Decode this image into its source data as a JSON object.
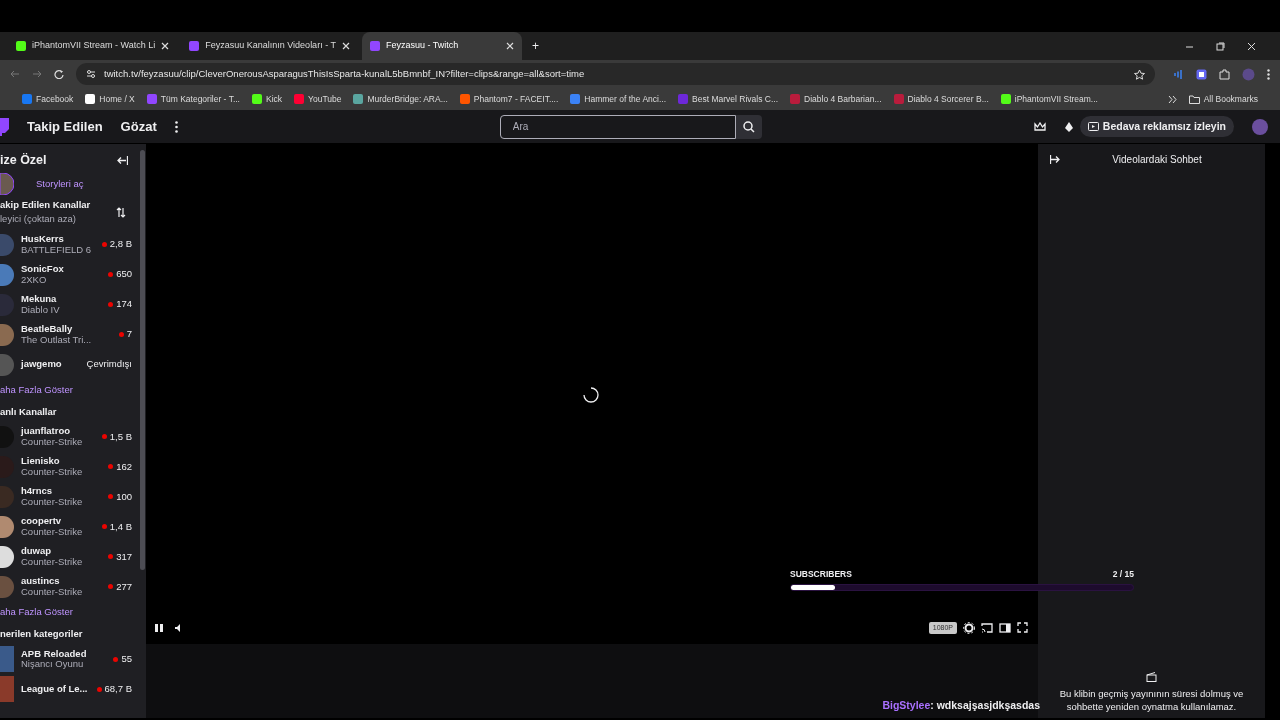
{
  "browser": {
    "tabs": [
      {
        "title": "iPhantomVII Stream - Watch Li",
        "kind": "kick",
        "selected": false
      },
      {
        "title": "Feyzasuu Kanalının Videoları - T",
        "kind": "twitch",
        "selected": false
      },
      {
        "title": "Feyzasuu - Twitch",
        "kind": "twitch",
        "selected": true
      }
    ],
    "new_tab": "+",
    "url": "twitch.tv/feyzasuu/clip/CleverOnerousAsparagusThisIsSparta-kunalL5bBmnbf_IN?filter=clips&range=all&sort=time",
    "bookmarks": [
      {
        "label": "Facebook",
        "color": "#1877f2"
      },
      {
        "label": "Home / X",
        "color": "#ffffff"
      },
      {
        "label": "Tüm Kategoriler - T...",
        "color": "#9146ff"
      },
      {
        "label": "Kick",
        "color": "#53fc18"
      },
      {
        "label": "YouTube",
        "color": "#ff0033"
      },
      {
        "label": "MurderBridge: ARA...",
        "color": "#5aa6a0"
      },
      {
        "label": "Phantom7 - FACEIT....",
        "color": "#ff5500"
      },
      {
        "label": "Hammer of the Anci...",
        "color": "#3b82f6"
      },
      {
        "label": "Best Marvel Rivals C...",
        "color": "#6d28d9"
      },
      {
        "label": "Diablo 4 Barbarian...",
        "color": "#b91c3c"
      },
      {
        "label": "Diablo 4 Sorcerer B...",
        "color": "#b91c3c"
      },
      {
        "label": "iPhantomVII Stream...",
        "color": "#53fc18"
      }
    ],
    "all_bookmarks": "All Bookmarks"
  },
  "nav": {
    "links": [
      "Takip Edilen",
      "Gözat"
    ],
    "search": {
      "placeholder": "Ara"
    },
    "promo_button": "Bedava reklamsız izleyin"
  },
  "sidebar": {
    "title": "ize Özel",
    "stories": "Storyleri aç",
    "followed_header": {
      "title": "akip Edilen Kanallar",
      "sort": "leyici (çoktan aza)"
    },
    "followed": [
      {
        "name": "HusKerrs",
        "game": "BATTLEFIELD 6",
        "viewers": "2,8 B",
        "kind": "live"
      },
      {
        "name": "SonicFox",
        "game": "2XKO",
        "viewers": "650",
        "kind": "live"
      },
      {
        "name": "Mekuna",
        "game": "Diablo IV",
        "viewers": "174",
        "kind": "live"
      },
      {
        "name": "BeatleBally",
        "game": "The Outlast Tri...",
        "viewers": "7",
        "kind": "live"
      },
      {
        "name": "jawgemo",
        "status": "Çevrimdışı",
        "kind": "offline"
      }
    ],
    "show_more_1": "aha Fazla Göster",
    "live_header": "anlı Kanallar",
    "live": [
      {
        "name": "juanflatroo",
        "game": "Counter-Strike",
        "viewers": "1,5 B",
        "kind": "live"
      },
      {
        "name": "Lienisko",
        "game": "Counter-Strike",
        "viewers": "162",
        "kind": "live"
      },
      {
        "name": "h4rncs",
        "game": "Counter-Strike",
        "viewers": "100",
        "kind": "live"
      },
      {
        "name": "coopertv",
        "game": "Counter-Strike",
        "viewers": "1,4 B",
        "kind": "live"
      },
      {
        "name": "duwap",
        "game": "Counter-Strike",
        "viewers": "317",
        "kind": "live"
      },
      {
        "name": "austincs",
        "game": "Counter-Strike",
        "viewers": "277",
        "kind": "live"
      }
    ],
    "show_more_2": "aha Fazla Göster",
    "categories_header": "nerilen kategoriler",
    "categories": [
      {
        "name": "APB Reloaded",
        "genre": "Nişancı Oyunu",
        "viewers": "55"
      },
      {
        "name": "League of Le...",
        "viewers": "68,7 B"
      }
    ]
  },
  "player": {
    "playing": true,
    "quality": "1080P",
    "goal": {
      "label": "SUBSCRIBERS",
      "count": "2 / 15",
      "level": 0.13
    },
    "chat_overlay": {
      "user": "BigStylee",
      "message": ": wdksajşasjdkşasdas"
    }
  },
  "chat": {
    "title": "Videolardaki Sohbet",
    "notice": "Bu klibin geçmiş yayınının süresi dolmuş ve sohbette yeniden oynatma kullanılamaz."
  }
}
